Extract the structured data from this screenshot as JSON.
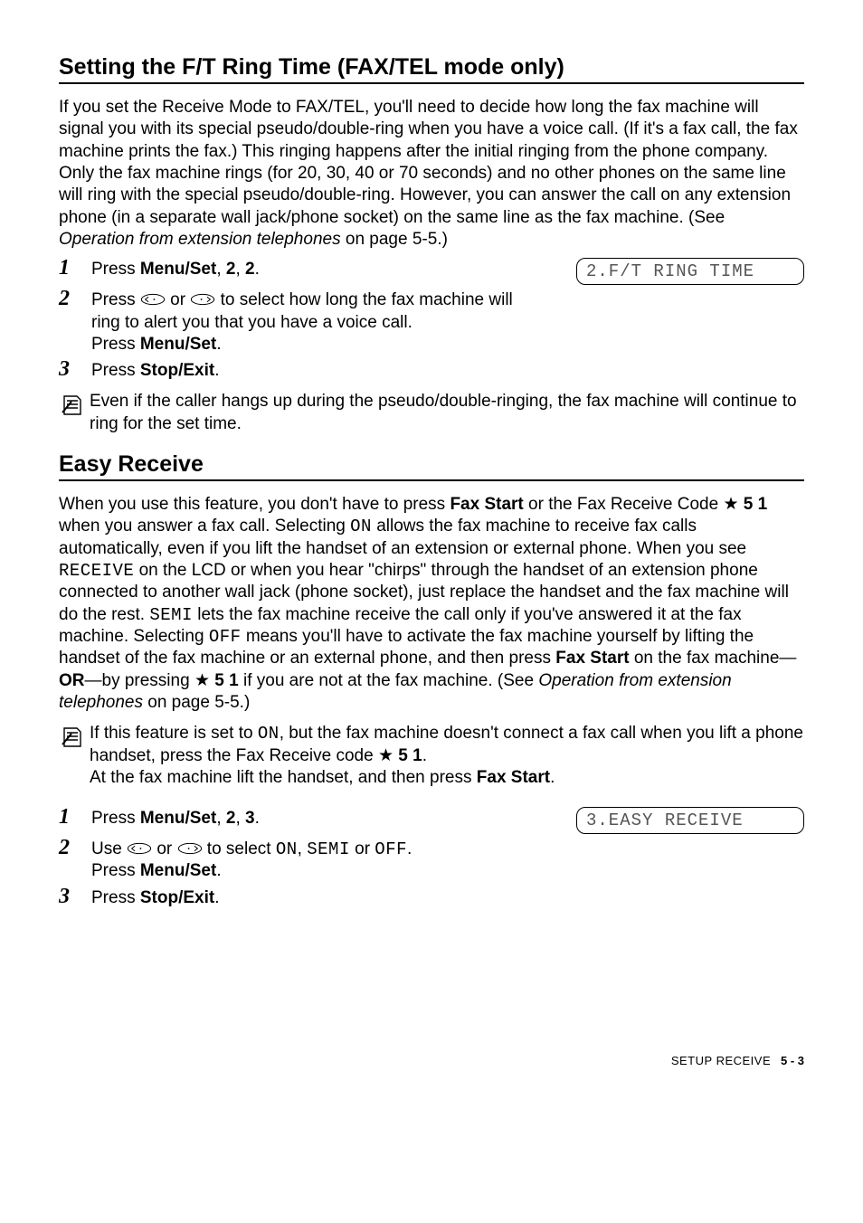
{
  "section1": {
    "title": "Setting the F/T Ring Time (FAX/TEL mode only)",
    "intro_html": "If you set the Receive Mode to FAX/TEL, you'll need to decide how long the fax machine will signal you with its special pseudo/double-ring when you have a voice call. (If it's a fax call, the fax machine prints the fax.) This ringing happens after the initial ringing from the phone company. Only the fax machine rings (for 20, 30, 40 or 70 seconds) and no other phones on the same line will ring with the special pseudo/double-ring. However, you can answer the call on any extension phone (in a separate wall jack/phone socket) on the same line as the fax machine. (See <em data-name=\"xref\" data-interactable=\"false\">Operation from extension telephones</em> on page 5-5.)",
    "steps": [
      {
        "num": "1",
        "html": "Press <strong>Menu/Set</strong>, <strong>2</strong>, <strong>2</strong>."
      },
      {
        "num": "2",
        "html": "Press <svg class=\"arrow-svg\" data-name=\"nav-left-icon\" data-interactable=\"false\" viewBox=\"0 0 40 20\" stroke=\"#000\" fill=\"none\" stroke-width=\"1.4\"><ellipse cx=\"20\" cy=\"10\" rx=\"18\" ry=\"8\"/><path d=\"M13 6 L8 10 L13 14\"/><circle cx=\"22\" cy=\"10\" r=\"1.3\" fill=\"#000\" stroke=\"none\"/></svg> or <svg class=\"arrow-svg\" data-name=\"nav-right-icon\" data-interactable=\"false\" viewBox=\"0 0 40 20\" stroke=\"#000\" fill=\"none\" stroke-width=\"1.4\"><ellipse cx=\"20\" cy=\"10\" rx=\"18\" ry=\"8\"/><circle cx=\"18\" cy=\"10\" r=\"1.3\" fill=\"#000\" stroke=\"none\"/><path d=\"M27 6 L32 10 L27 14\"/></svg> to select how long the fax machine will ring to alert you that you have a voice call.<br>Press <strong>Menu/Set</strong>."
      },
      {
        "num": "3",
        "html": "Press <strong>Stop/Exit</strong>."
      }
    ],
    "lcd": "2.F/T RING TIME",
    "note": "Even if the caller hangs up during the pseudo/double-ringing, the fax machine will continue to ring for the set time."
  },
  "section2": {
    "title": "Easy Receive",
    "intro_html": "When you use this feature, you don't have to press <strong>Fax Start</strong> or the Fax Receive Code <span class=\"star\">&#9733;</span> <strong>5 1</strong> when you answer a fax call. Selecting <span class=\"mono\">ON</span> allows the fax machine to receive fax calls automatically, even if you lift the handset of an extension or external phone. When you see <span class=\"mono\">RECEIVE</span> on the LCD or when you hear \"chirps\" through the handset of an extension phone connected to another wall jack (phone socket), just replace the handset and the fax machine will do the rest. <span class=\"mono\">SEMI</span> lets the fax machine receive the call only if you've answered it at the fax machine. Selecting <span class=\"mono\">OFF</span> means you'll have to activate the fax machine yourself by lifting the handset of the fax machine or an external phone, and then press <strong>Fax Start</strong> on the fax machine—<strong>OR</strong>—by pressing <span class=\"star\">&#9733;</span> <strong>5 1</strong> if you are not at the fax machine. (See <em data-name=\"xref\" data-interactable=\"false\">Operation from extension telephones</em> on page 5-5.)",
    "note_html": "If this feature is set to <span class=\"mono\">ON</span>, but the fax machine doesn't connect a fax call when you lift a phone handset, press the Fax Receive code <span class=\"star\">&#9733;</span> <strong>5 1</strong>.<br>At the fax machine lift the handset, and then press <strong>Fax Start</strong>.",
    "steps": [
      {
        "num": "1",
        "html": "Press <strong>Menu/Set</strong>, <strong>2</strong>, <strong>3</strong>."
      },
      {
        "num": "2",
        "html": "Use <svg class=\"arrow-svg\" data-name=\"nav-left-icon\" data-interactable=\"false\" viewBox=\"0 0 40 20\" stroke=\"#000\" fill=\"none\" stroke-width=\"1.4\"><ellipse cx=\"20\" cy=\"10\" rx=\"18\" ry=\"8\"/><path d=\"M13 6 L8 10 L13 14\"/><circle cx=\"22\" cy=\"10\" r=\"1.3\" fill=\"#000\" stroke=\"none\"/></svg> or <svg class=\"arrow-svg\" data-name=\"nav-right-icon\" data-interactable=\"false\" viewBox=\"0 0 40 20\" stroke=\"#000\" fill=\"none\" stroke-width=\"1.4\"><ellipse cx=\"20\" cy=\"10\" rx=\"18\" ry=\"8\"/><circle cx=\"18\" cy=\"10\" r=\"1.3\" fill=\"#000\" stroke=\"none\"/><path d=\"M27 6 L32 10 L27 14\"/></svg> to select <span class=\"mono\">ON</span>, <span class=\"mono\">SEMI</span> or <span class=\"mono\">OFF</span>.<br>Press <strong>Menu/Set</strong>."
      },
      {
        "num": "3",
        "html": "Press <strong>Stop/Exit</strong>."
      }
    ],
    "lcd": "3.EASY RECEIVE"
  },
  "footer": {
    "section": "SETUP RECEIVE",
    "page": "5 - 3"
  }
}
